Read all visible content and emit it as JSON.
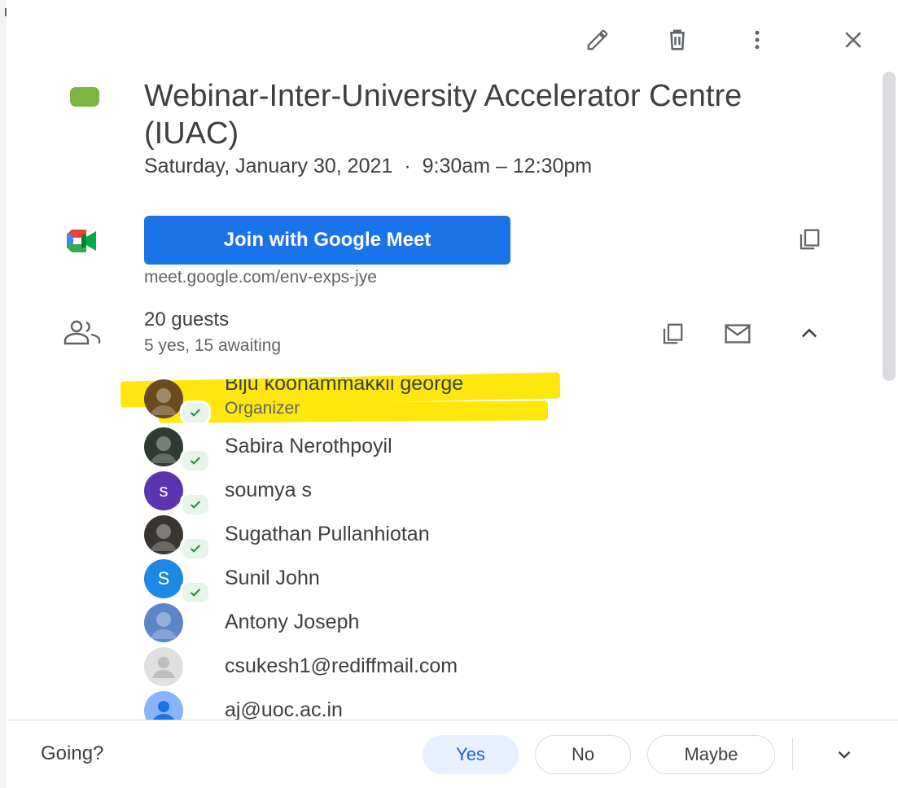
{
  "toolbar": {
    "edit_icon": "pencil-icon",
    "delete_icon": "trash-icon",
    "more_icon": "more-vert-icon",
    "close_icon": "close-icon"
  },
  "event": {
    "color": "#7cb342",
    "title": "Webinar-Inter-University Accelerator Centre (IUAC)",
    "date": "Saturday, January 30, 2021",
    "separator": "·",
    "time": "9:30am – 12:30pm"
  },
  "meet": {
    "button_label": "Join with Google Meet",
    "link": "meet.google.com/env-exps-jye",
    "button_color": "#1a73e8"
  },
  "guests": {
    "count_label": "20 guests",
    "summary": "5 yes, 15 awaiting",
    "list": [
      {
        "name": "Biju koonammakkil george",
        "role": "Organizer",
        "initial": "",
        "accepted": true,
        "avatar_color": "#6b4a1f"
      },
      {
        "name": "Sabira Nerothpoyil",
        "role": "",
        "initial": "",
        "accepted": true,
        "avatar_color": "#2f3a33"
      },
      {
        "name": "soumya s",
        "role": "",
        "initial": "s",
        "accepted": true,
        "avatar_color": "#5e35b1"
      },
      {
        "name": "Sugathan Pullanhiotan",
        "role": "",
        "initial": "",
        "accepted": true,
        "avatar_color": "#3a3530"
      },
      {
        "name": "Sunil John",
        "role": "",
        "initial": "S",
        "accepted": true,
        "avatar_color": "#1e88e5"
      },
      {
        "name": "Antony Joseph",
        "role": "",
        "initial": "",
        "accepted": false,
        "avatar_color": "#5b86c7"
      },
      {
        "name": "csukesh1@rediffmail.com",
        "role": "",
        "initial": "",
        "accepted": false,
        "avatar_color": "#e0e0e0"
      },
      {
        "name": "aj@uoc.ac.in",
        "role": "",
        "initial": "",
        "accepted": false,
        "avatar_color": "#8ab4f8"
      }
    ]
  },
  "footer": {
    "going_label": "Going?",
    "yes_label": "Yes",
    "no_label": "No",
    "maybe_label": "Maybe",
    "selected": "Yes"
  },
  "colors": {
    "accent": "#1a73e8",
    "highlight": "#ffe600",
    "accepted": "#1e8e3e"
  }
}
